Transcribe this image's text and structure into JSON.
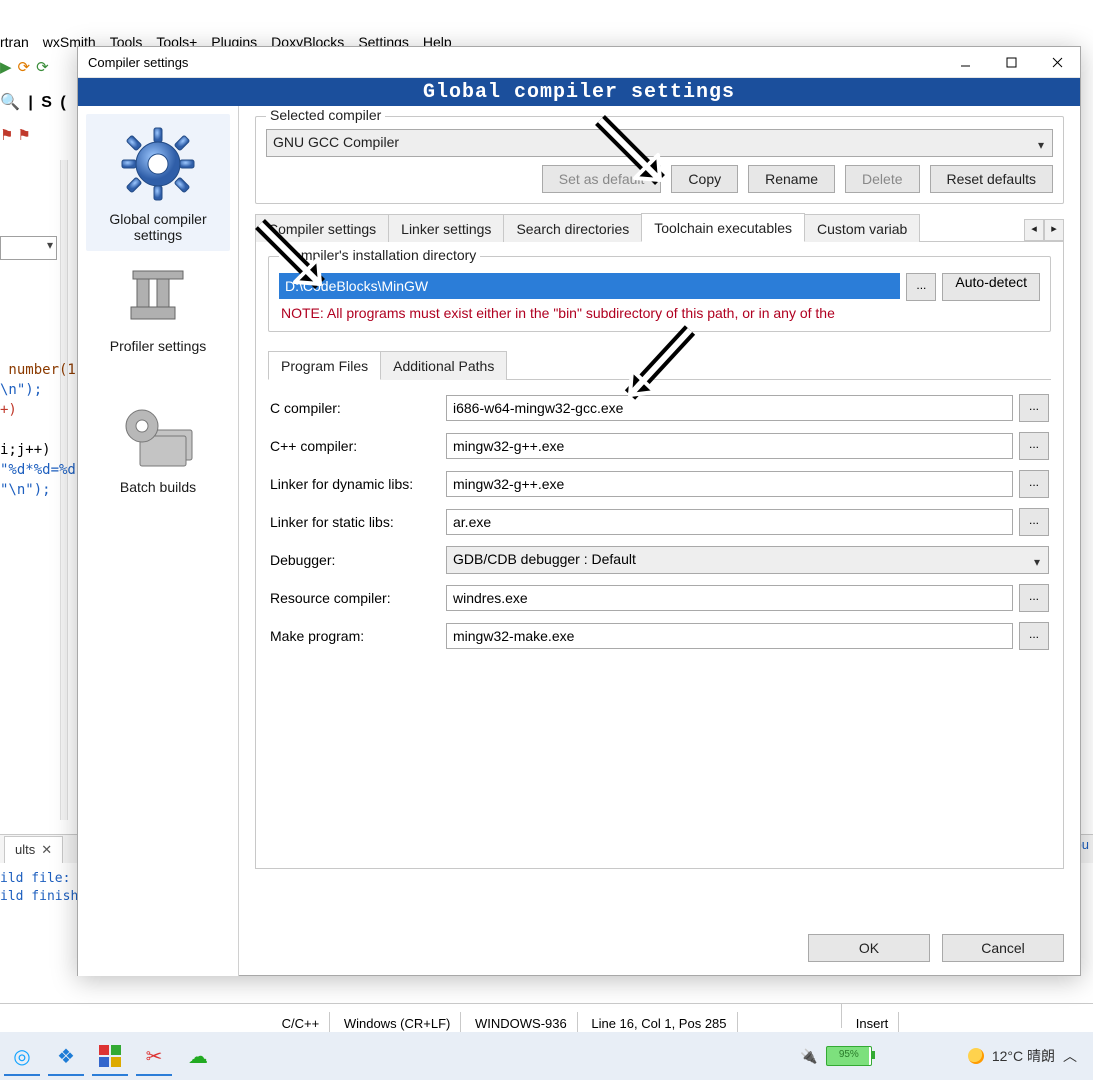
{
  "bgMenu": [
    "rtran",
    "wxSmith",
    "Tools",
    "Tools+",
    "Plugins",
    "DoxyBlocks",
    "Settings",
    "Help"
  ],
  "bgS": "S",
  "bgCode": {
    "numberLine": " number(1",
    "nl": "\\n\");",
    "plus": "+)",
    "ij": "i;j++)",
    "fmt": "\"%d*%d=%d",
    "nl2": "\"\\n\");"
  },
  "bgTab": "ults",
  "bgDebug": "Debu",
  "bgLog1": "ild file:",
  "bgLog2": "ild finish",
  "status": {
    "lang": "C/C++",
    "eol": "Windows (CR+LF)",
    "enc": "WINDOWS-936",
    "pos": "Line 16, Col 1, Pos 285",
    "mode": "Insert"
  },
  "taskbar": {
    "battery": "95%",
    "weather": "12°C 晴朗"
  },
  "dialog": {
    "title": "Compiler settings",
    "banner": "Global compiler settings",
    "nav": {
      "global": "Global compiler\nsettings",
      "profiler": "Profiler settings",
      "batch": "Batch builds"
    },
    "selectedGroup": "Selected compiler",
    "compilerName": "GNU GCC Compiler",
    "btns": {
      "setDefault": "Set as default",
      "copy": "Copy",
      "rename": "Rename",
      "delete": "Delete",
      "reset": "Reset defaults"
    },
    "tabs": {
      "compiler": "Compiler settings",
      "linker": "Linker settings",
      "search": "Search directories",
      "toolchain": "Toolchain executables",
      "custom": "Custom variab"
    },
    "instGroup": "Compiler's installation directory",
    "instDir": "D:\\CodeBlocks\\MinGW",
    "autoDetect": "Auto-detect",
    "noteText": "NOTE: All programs must exist either in the \"bin\" subdirectory of this path, or in any of the",
    "subTabs": {
      "prog": "Program Files",
      "paths": "Additional Paths"
    },
    "rows": {
      "cComp": {
        "label": "C compiler:",
        "value": "i686-w64-mingw32-gcc.exe"
      },
      "cppComp": {
        "label": "C++ compiler:",
        "value": "mingw32-g++.exe"
      },
      "linkDyn": {
        "label": "Linker for dynamic libs:",
        "value": "mingw32-g++.exe"
      },
      "linkStat": {
        "label": "Linker for static libs:",
        "value": "ar.exe"
      },
      "debugger": {
        "label": "Debugger:",
        "value": "GDB/CDB debugger : Default"
      },
      "resComp": {
        "label": "Resource compiler:",
        "value": "windres.exe"
      },
      "make": {
        "label": "Make program:",
        "value": "mingw32-make.exe"
      }
    },
    "ok": "OK",
    "cancel": "Cancel"
  }
}
